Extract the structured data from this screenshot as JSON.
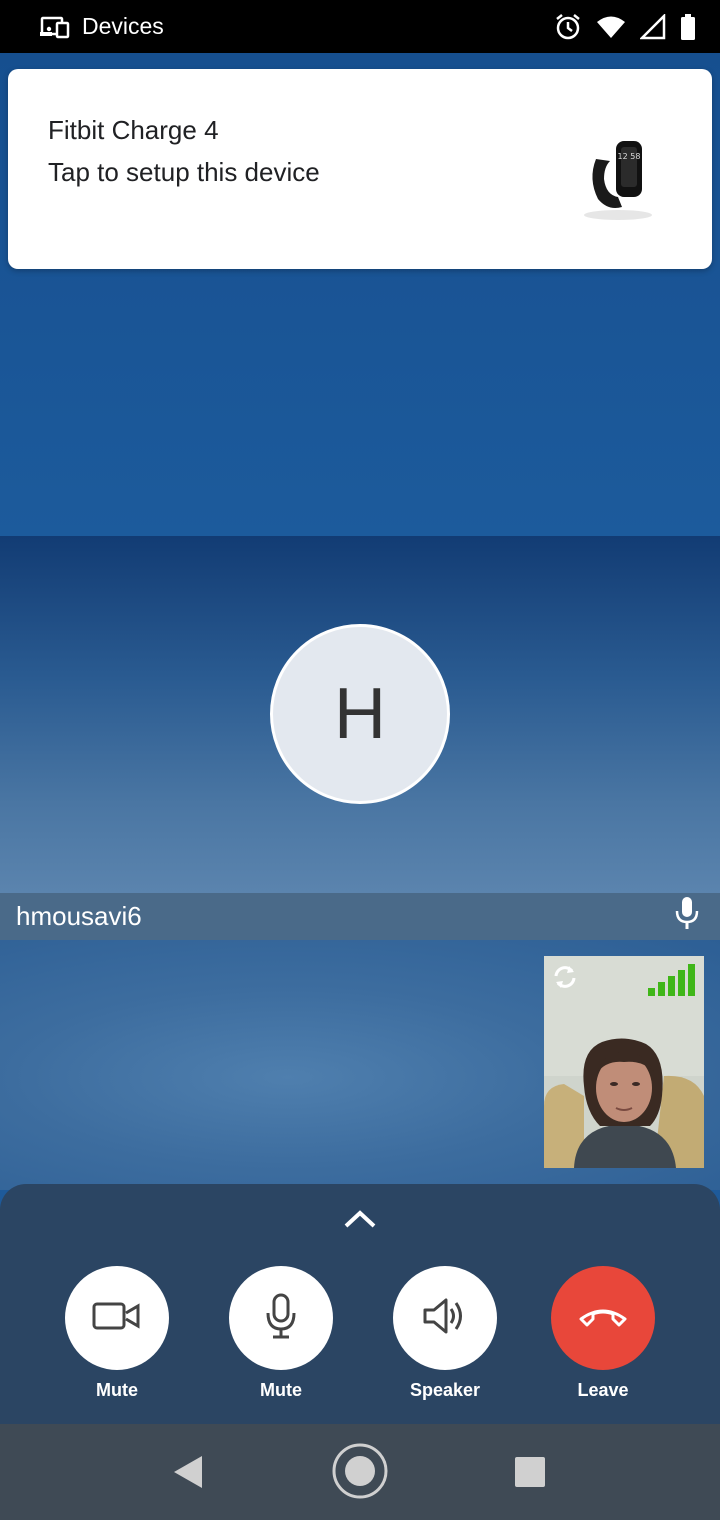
{
  "status_bar": {
    "app_label": "Devices",
    "icons": [
      "devices-icon",
      "alarm-icon",
      "wifi-icon",
      "cell-signal-icon",
      "battery-icon"
    ]
  },
  "notification": {
    "title": "Fitbit Charge 4",
    "subtitle": "Tap to setup this device",
    "image": "fitbit-charge-4-device-image",
    "watch_text": "12 58"
  },
  "participant": {
    "initial": "H",
    "name": "hmousavi6",
    "mic_icon": "microphone-icon"
  },
  "self_view": {
    "icons": [
      "switch-camera-icon",
      "signal-strength-icon"
    ],
    "signal_color": "#3fb618"
  },
  "controls": {
    "expand_icon": "chevron-up-icon",
    "video": {
      "label": "Mute",
      "icon": "video-camera-icon"
    },
    "audio": {
      "label": "Mute",
      "icon": "microphone-icon"
    },
    "speaker": {
      "label": "Speaker",
      "icon": "speaker-icon"
    },
    "leave": {
      "label": "Leave",
      "icon": "hang-up-icon",
      "color": "#e8473a"
    }
  },
  "nav_bar": {
    "icons": [
      "back-icon",
      "home-icon",
      "recents-icon"
    ]
  }
}
